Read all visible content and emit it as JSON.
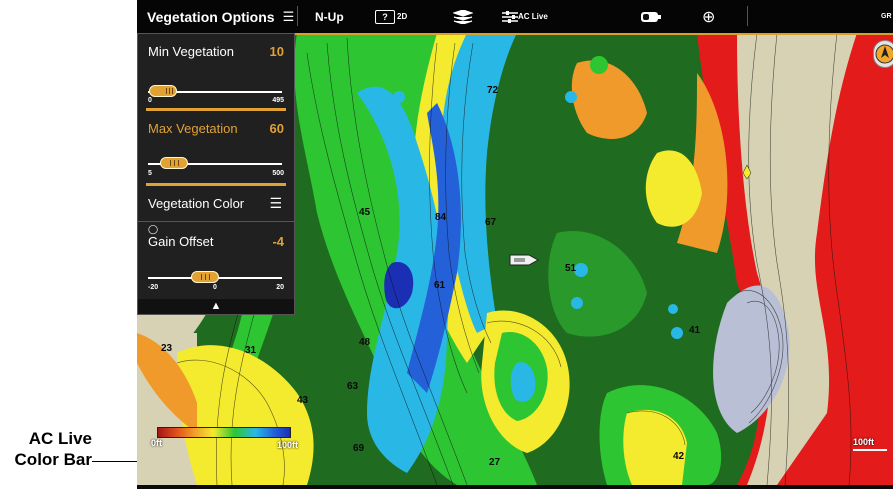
{
  "callout": {
    "line1": "AC Live",
    "line2": "Color Bar"
  },
  "topbar": {
    "menu_title": "Vegetation Options",
    "orientation": "N-Up",
    "view_mode": "2D",
    "overlay_label": "AC Live",
    "right_label": "GR"
  },
  "panel": {
    "min_vegetation": {
      "label": "Min Vegetation",
      "value": "10",
      "range_min": "0",
      "range_max": "495"
    },
    "max_vegetation": {
      "label": "Max Vegetation",
      "value": "60",
      "range_min": "5",
      "range_max": "500"
    },
    "vegetation_color": {
      "label": "Vegetation Color"
    },
    "gain_offset": {
      "label": "Gain Offset",
      "value": "-4",
      "range_min": "-20",
      "range_mid": "0",
      "range_max": "20"
    }
  },
  "colorbar": {
    "min_label": "0ft",
    "max_label": "100ft"
  },
  "scale": {
    "label": "100ft"
  },
  "depth_labels": [
    "84",
    "67",
    "45",
    "61",
    "48",
    "63",
    "43",
    "69",
    "27",
    "42",
    "72",
    "51",
    "41",
    "23",
    "31"
  ],
  "colors": {
    "accent": "#e2a133",
    "vegetation": "#1f6b20",
    "shoreline": "#d8d2b4"
  }
}
